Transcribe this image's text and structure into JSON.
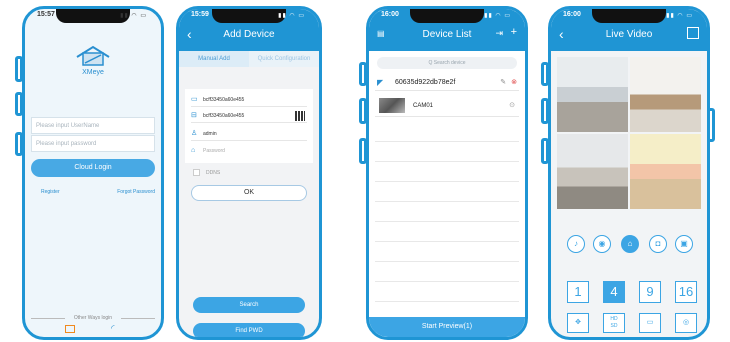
{
  "login": {
    "time": "15:57",
    "app_name": "XMeye",
    "username_placeholder": "Please input UserName",
    "password_placeholder": "Please input password",
    "cloud_login": "Cloud Login",
    "register": "Register",
    "forgot_password": "Forgot Password",
    "other_ways": "Other Ways login"
  },
  "add_device": {
    "time": "15:59",
    "title": "Add Device",
    "tabs": [
      "Manual Add",
      "Quick Configuration"
    ],
    "fields": [
      "bcff33450a60e455",
      "bcff33450a60e455",
      "admin",
      "Password"
    ],
    "ddns": "DDNS",
    "ok": "OK",
    "search": "Search",
    "find_pwd": "Find PWD"
  },
  "device_list": {
    "time": "16:00",
    "title": "Device List",
    "search_placeholder": "Q  Search device",
    "device_id": "60635d922db78e2f",
    "camera": "CAM01",
    "start_preview": "Start Preview(1)"
  },
  "live_video": {
    "time": "16:00",
    "title": "Live Video",
    "grid_options": [
      "1",
      "4",
      "9",
      "16"
    ],
    "selected_grid": "4",
    "hd_label": "HD",
    "sd_label": "SD"
  },
  "colors": {
    "accent": "#1f95d4"
  }
}
